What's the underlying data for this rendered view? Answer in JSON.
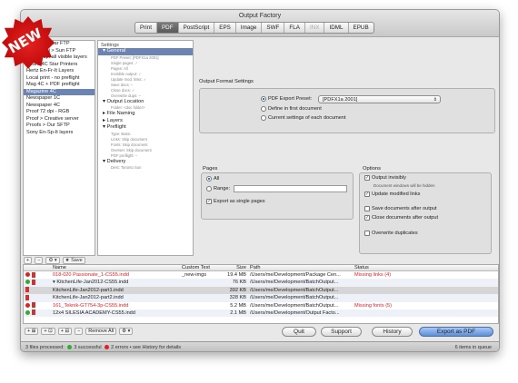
{
  "window": {
    "title": "Output Factory"
  },
  "ribbon": {
    "text": "NEW"
  },
  "tabs": [
    {
      "label": "Print",
      "active": false,
      "dim": false
    },
    {
      "label": "PDF",
      "active": true,
      "dim": false
    },
    {
      "label": "PostScript",
      "active": false,
      "dim": false
    },
    {
      "label": "EPS",
      "active": false,
      "dim": false
    },
    {
      "label": "Image",
      "active": false,
      "dim": false
    },
    {
      "label": "SWF",
      "active": false,
      "dim": false
    },
    {
      "label": "FLA",
      "active": false,
      "dim": false
    },
    {
      "label": "INX",
      "active": false,
      "dim": true
    },
    {
      "label": "IDML",
      "active": false,
      "dim": false
    },
    {
      "label": "EPUB",
      "active": false,
      "dim": false
    }
  ],
  "sidebar": {
    "items": [
      "Board 4C Star FTP",
      "4C-300dpi > Sun FTP",
      "4C-300dpi-all visible layers",
      "Board 4C Star Printers",
      "Hertz En-Fr-It Layers",
      "Local print - no preflight",
      "Mag 4C + PDF preflight",
      "Magazine 4C",
      "Newspaper 1C",
      "Newspaper 4C",
      "Proof 72 dpi - RGB",
      "Proof > Creative server",
      "Proofs > Our SFTP",
      "Sony En-Sp-It layers"
    ],
    "selected_index": 7,
    "tools": [
      "+",
      "−",
      "⚙ ▾",
      "★ Save"
    ]
  },
  "tree": {
    "header": "Settings",
    "nodes": [
      {
        "label": "▾ General",
        "selected": true,
        "subs": [
          "PDF Preset: [PDFX1a 2001]",
          "Single pages: ✓",
          "Pages: All",
          "Invisible output: ✓",
          "Update mod. links: ✓",
          "Save docs: –",
          "Close docs: ✓",
          "Overwrite dups: –"
        ]
      },
      {
        "label": "▾ Output Location",
        "selected": false,
        "subs": [
          "Folder: <doc folder>"
        ]
      },
      {
        "label": "▸ File Naming",
        "selected": false,
        "subs": []
      },
      {
        "label": "▸ Layers",
        "selected": false,
        "subs": []
      },
      {
        "label": "▾ Preflight",
        "selected": false,
        "subs": [
          "Type: Basic",
          "Links: Skip document",
          "Fonts: Skip document",
          "Overset: Skip document",
          "PDF preflight: –"
        ]
      },
      {
        "label": "▾ Delivery",
        "selected": false,
        "subs": [
          "Dest: Toronto Sun"
        ]
      }
    ]
  },
  "output_format": {
    "title": "Output Format Settings",
    "option1": "PDF Export Preset:",
    "preset": "[PDFX1a 2001]",
    "option2": "Define in first document",
    "option3": "Current settings of each document"
  },
  "pages": {
    "title": "Pages",
    "all": "All",
    "range": "Range:",
    "range_value": "",
    "export_single": "Export as single pages"
  },
  "options": {
    "title": "Options",
    "output_invisibly": "Output invisibly",
    "hidden_note": "Document windows will be hidden",
    "update_links": "Update modified links",
    "save_docs": "Save documents after output",
    "close_docs": "Close documents after output",
    "overwrite": "Overwrite duplicates"
  },
  "list": {
    "headers": [
      "",
      "Name",
      "Custom Text",
      "Size",
      "Path",
      "Status"
    ],
    "rows": [
      {
        "state": "red",
        "name": "018-020 Passionate_1-CS55.indd",
        "custom": "_new-imgs",
        "size": "19.4 MB",
        "path": "/Users/me/Development/Package Cen...",
        "status": "Missing links (4)",
        "name_red": true,
        "alt": false,
        "sel": false
      },
      {
        "state": "green",
        "name": "▾ KitchenLife-Jan2012-CS55.indd",
        "custom": "",
        "size": "76 KB",
        "path": "/Users/me/Development/BatchOutput...",
        "status": "",
        "name_red": false,
        "alt": true,
        "sel": false
      },
      {
        "state": "",
        "name": "KitchenLife-Jan2012-part1.indd",
        "custom": "",
        "size": "392 KB",
        "path": "/Users/me/Development/BatchOutput...",
        "status": "",
        "name_red": false,
        "alt": false,
        "sel": true
      },
      {
        "state": "",
        "name": "KitchenLife-Jan2012-part2.indd",
        "custom": "",
        "size": "328 KB",
        "path": "/Users/me/Development/BatchOutput...",
        "status": "",
        "name_red": false,
        "alt": true,
        "sel": false
      },
      {
        "state": "red",
        "name": "161_Teknik-GT754-3p-CS55.indd",
        "custom": "",
        "size": "5.2 MB",
        "path": "/Users/me/Development/BatchOutput...",
        "status": "Missing fonts (5)",
        "name_red": true,
        "alt": false,
        "sel": false
      },
      {
        "state": "green",
        "name": "12x4 SILESIA ACADEMY-CS55.indd",
        "custom": "",
        "size": "2.1 MB",
        "path": "/Users/me/Development/Output Facto...",
        "status": "",
        "name_red": false,
        "alt": true,
        "sel": false
      }
    ]
  },
  "bottom_tools": [
    "+ ⊞",
    "+ ⊡",
    "+ ⊟",
    "−",
    "Remove All",
    "⚙ ▾"
  ],
  "buttons": {
    "quit": "Quit",
    "support": "Support",
    "history": "History",
    "export": "Export as PDF"
  },
  "status": {
    "processed": "3 files processed:",
    "successful": "3 successful",
    "errors": "2 errors",
    "see_history": "• see History for details",
    "queue": "6 items in queue"
  },
  "colors": {
    "selection": "#6c84b4",
    "error": "#dd2222",
    "success": "#33aa33",
    "primary_button": "#5b8fd9"
  }
}
